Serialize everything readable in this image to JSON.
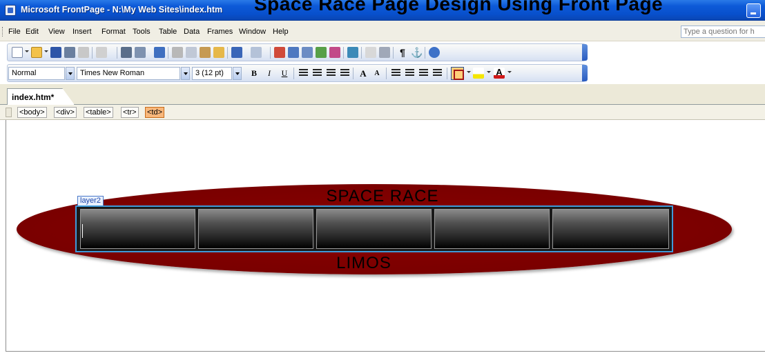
{
  "window": {
    "title": "Microsoft FrontPage - N:\\My Web Sites\\index.htm",
    "overlay_caption": "Space Race Page Design Using Front Page"
  },
  "menu": {
    "items": [
      "File",
      "Edit",
      "View",
      "Insert",
      "Format",
      "Tools",
      "Table",
      "Data",
      "Frames",
      "Window",
      "Help"
    ],
    "help_search_placeholder": "Type a question for h"
  },
  "formatting_toolbar": {
    "style": "Normal",
    "font": "Times New Roman",
    "size": "3  (12 pt)",
    "bold": "B",
    "italic": "I",
    "underline": "U",
    "grow_font": "A",
    "shrink_font": "A"
  },
  "document": {
    "tab_label": "index.htm*",
    "tag_path": [
      "<body>",
      "<div>",
      "<table>",
      "<tr>",
      "<td>"
    ],
    "active_tag": "<td>"
  },
  "canvas": {
    "ellipse_title": "SPACE RACE",
    "ellipse_subtitle": "LIMOS",
    "layer_label": "layer2",
    "ellipse_color": "#7a0000",
    "layer_border_color": "#3f9ad9",
    "cell_count": 5
  }
}
